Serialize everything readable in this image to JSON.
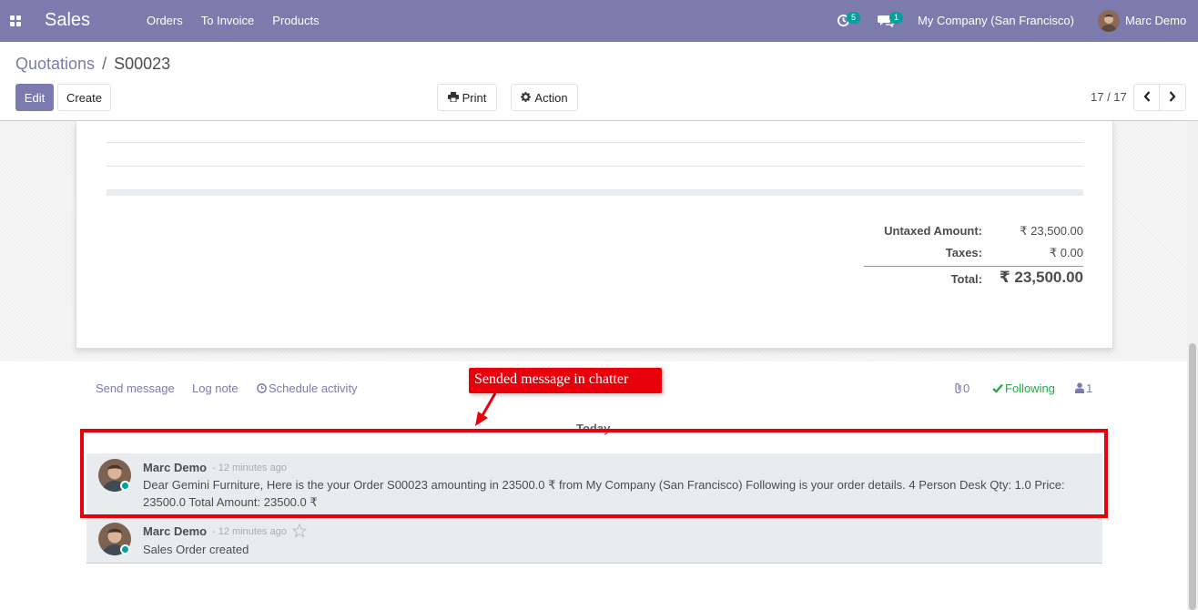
{
  "navbar": {
    "app_name": "Sales",
    "menu": [
      "Orders",
      "To Invoice",
      "Products"
    ],
    "activity_badge": "5",
    "messages_badge": "1",
    "company": "My Company (San Francisco)",
    "user": "Marc Demo",
    "accent": "#7c7bad"
  },
  "control": {
    "breadcrumb_parent": "Quotations",
    "breadcrumb_sep": "/",
    "breadcrumb_current": "S00023",
    "edit_label": "Edit",
    "create_label": "Create",
    "print_label": "Print",
    "action_label": "Action",
    "pager": "17 / 17"
  },
  "totals": {
    "untaxed_label": "Untaxed Amount:",
    "untaxed_value": "₹ 23,500.00",
    "taxes_label": "Taxes:",
    "taxes_value": "₹ 0.00",
    "total_label": "Total:",
    "total_value": "₹ 23,500.00"
  },
  "chatter": {
    "send_message": "Send message",
    "log_note": "Log note",
    "schedule_activity": "Schedule activity",
    "attachments_count": "0",
    "following_label": "Following",
    "followers_count": "1",
    "date_separator": "Today",
    "messages": [
      {
        "author": "Marc Demo",
        "time": "- 12 minutes ago",
        "body": "Dear Gemini Furniture, Here is the your Order S00023 amounting in 23500.0 ₹ from My Company (San Francisco) Following is your order details. 4 Person Desk Qty: 1.0 Price: 23500.0 Total Amount: 23500.0 ₹"
      },
      {
        "author": "Marc Demo",
        "time": "- 12 minutes ago",
        "body": "Sales Order created"
      }
    ]
  },
  "annotation": {
    "label": "Sended message in chatter",
    "color": "#e8000b"
  }
}
